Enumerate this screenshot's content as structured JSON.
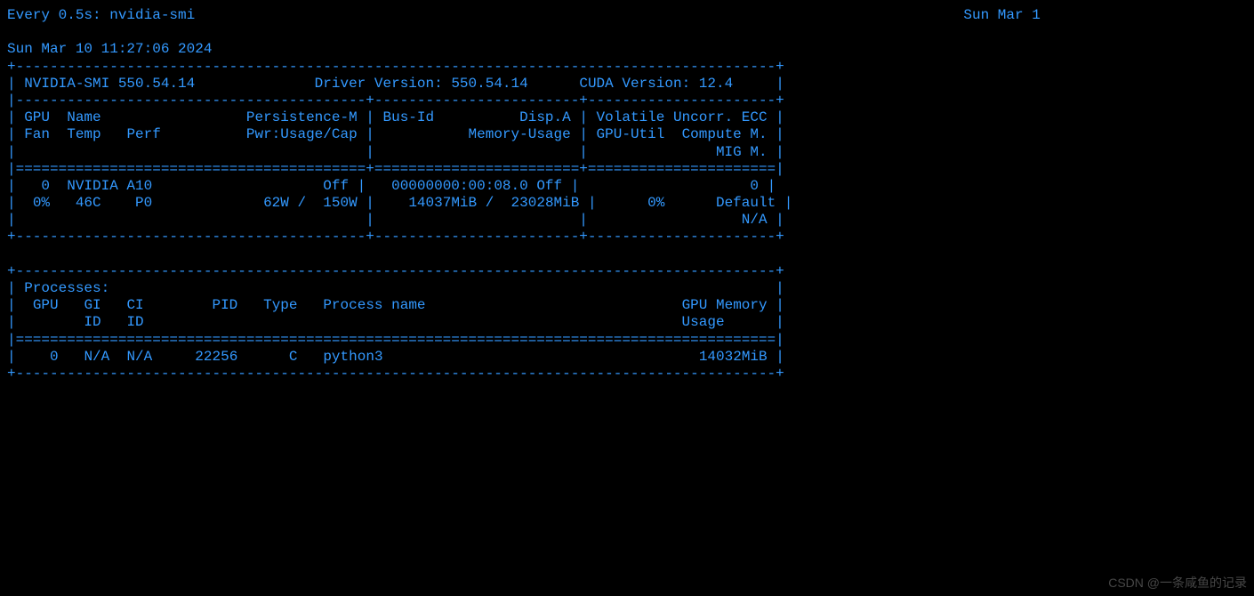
{
  "watch": {
    "interval_line": "Every 0.5s: nvidia-smi",
    "date_right": "Sun Mar 1"
  },
  "timestamp": "Sun Mar 10 11:27:06 2024",
  "header": {
    "smi_version_label": "NVIDIA-SMI",
    "smi_version": "550.54.14",
    "driver_label": "Driver Version:",
    "driver_version": "550.54.14",
    "cuda_label": "CUDA Version:",
    "cuda_version": "12.4"
  },
  "columns": {
    "gpu": "GPU",
    "name": "Name",
    "persistence": "Persistence-M",
    "busid": "Bus-Id",
    "dispa": "Disp.A",
    "ecc": "Volatile Uncorr. ECC",
    "fan": "Fan",
    "temp": "Temp",
    "perf": "Perf",
    "pwr": "Pwr:Usage/Cap",
    "memusage": "Memory-Usage",
    "gpuutil": "GPU-Util",
    "computem": "Compute M.",
    "migm": "MIG M."
  },
  "gpu": {
    "index": "0",
    "name": "NVIDIA A10",
    "persistence": "Off",
    "busid": "00000000:00:08.0",
    "dispa": "Off",
    "ecc": "0",
    "fan": "0%",
    "temp": "46C",
    "perf": "P0",
    "pwr_usage": "62W",
    "pwr_cap": "150W",
    "mem_used": "14037MiB",
    "mem_total": "23028MiB",
    "util": "0%",
    "compute_mode": "Default",
    "mig_mode": "N/A"
  },
  "processes": {
    "title": "Processes:",
    "headers": {
      "gpu": "GPU",
      "gi": "GI",
      "gi2": "ID",
      "ci": "CI",
      "ci2": "ID",
      "pid": "PID",
      "type": "Type",
      "pname": "Process name",
      "gpumem": "GPU Memory",
      "usage": "Usage"
    },
    "rows": [
      {
        "gpu": "0",
        "gi": "N/A",
        "ci": "N/A",
        "pid": "22256",
        "type": "C",
        "pname": "python3",
        "mem": "14032MiB"
      }
    ]
  },
  "watermark": "CSDN @一条咸鱼的记录"
}
